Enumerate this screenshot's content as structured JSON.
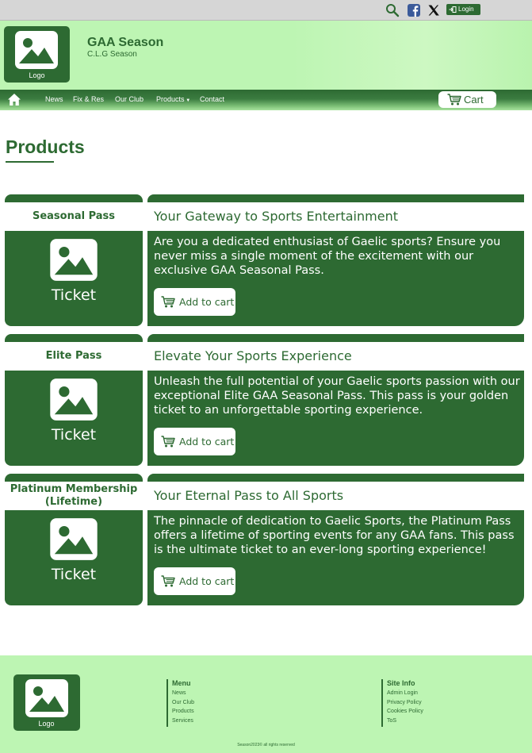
{
  "topbar": {
    "icons": [
      "search-icon",
      "facebook-icon",
      "x-icon"
    ],
    "login_label": "Login"
  },
  "header": {
    "logo_label": "Logo",
    "title": "GAA Season",
    "subtitle": "C.L.G Season"
  },
  "nav": {
    "items": [
      "News",
      "Fix & Res",
      "Our Club",
      "Products",
      "Contact"
    ],
    "cart_label": "Cart"
  },
  "page": {
    "heading": "Products"
  },
  "products": [
    {
      "name": "Seasonal Pass",
      "image_label": "Ticket",
      "title": "Your Gateway to Sports Entertainment",
      "description": "Are you a dedicated enthusiast of Gaelic sports? Ensure you never miss a single moment of the excitement with our exclusive GAA Seasonal Pass.",
      "button_label": "Add to cart"
    },
    {
      "name": "Elite Pass",
      "image_label": "Ticket",
      "title": "Elevate Your Sports Experience",
      "description": "Unleash the full potential of your Gaelic sports passion with our exceptional Elite GAA Seasonal Pass.  This pass is your golden ticket to an unforgettable sporting experience.",
      "button_label": "Add to cart"
    },
    {
      "name": "Platinum Membership (Lifetime)",
      "image_label": "Ticket",
      "title": "Your Eternal Pass to All Sports",
      "description": "The pinnacle of dedication to Gaelic Sports, the Platinum Pass offers a lifetime of sporting events for any GAA fans. This pass is the ultimate ticket to an ever-long sporting experience!",
      "button_label": "Add to cart"
    }
  ],
  "footer": {
    "logo_label": "Logo",
    "menu": {
      "title": "Menu",
      "links": [
        "News",
        "Our Club",
        "Products",
        "Services"
      ]
    },
    "site_info": {
      "title": "Site Info",
      "links": [
        "Admin Login",
        "Privacy Policy",
        "Cookies Policy",
        "ToS"
      ]
    },
    "copyright": "Season2023© all rights reserved"
  },
  "colors": {
    "primary": "#2d6a32",
    "light_green": "#bdf5b3",
    "topbar_gray": "#d6d6d6"
  }
}
